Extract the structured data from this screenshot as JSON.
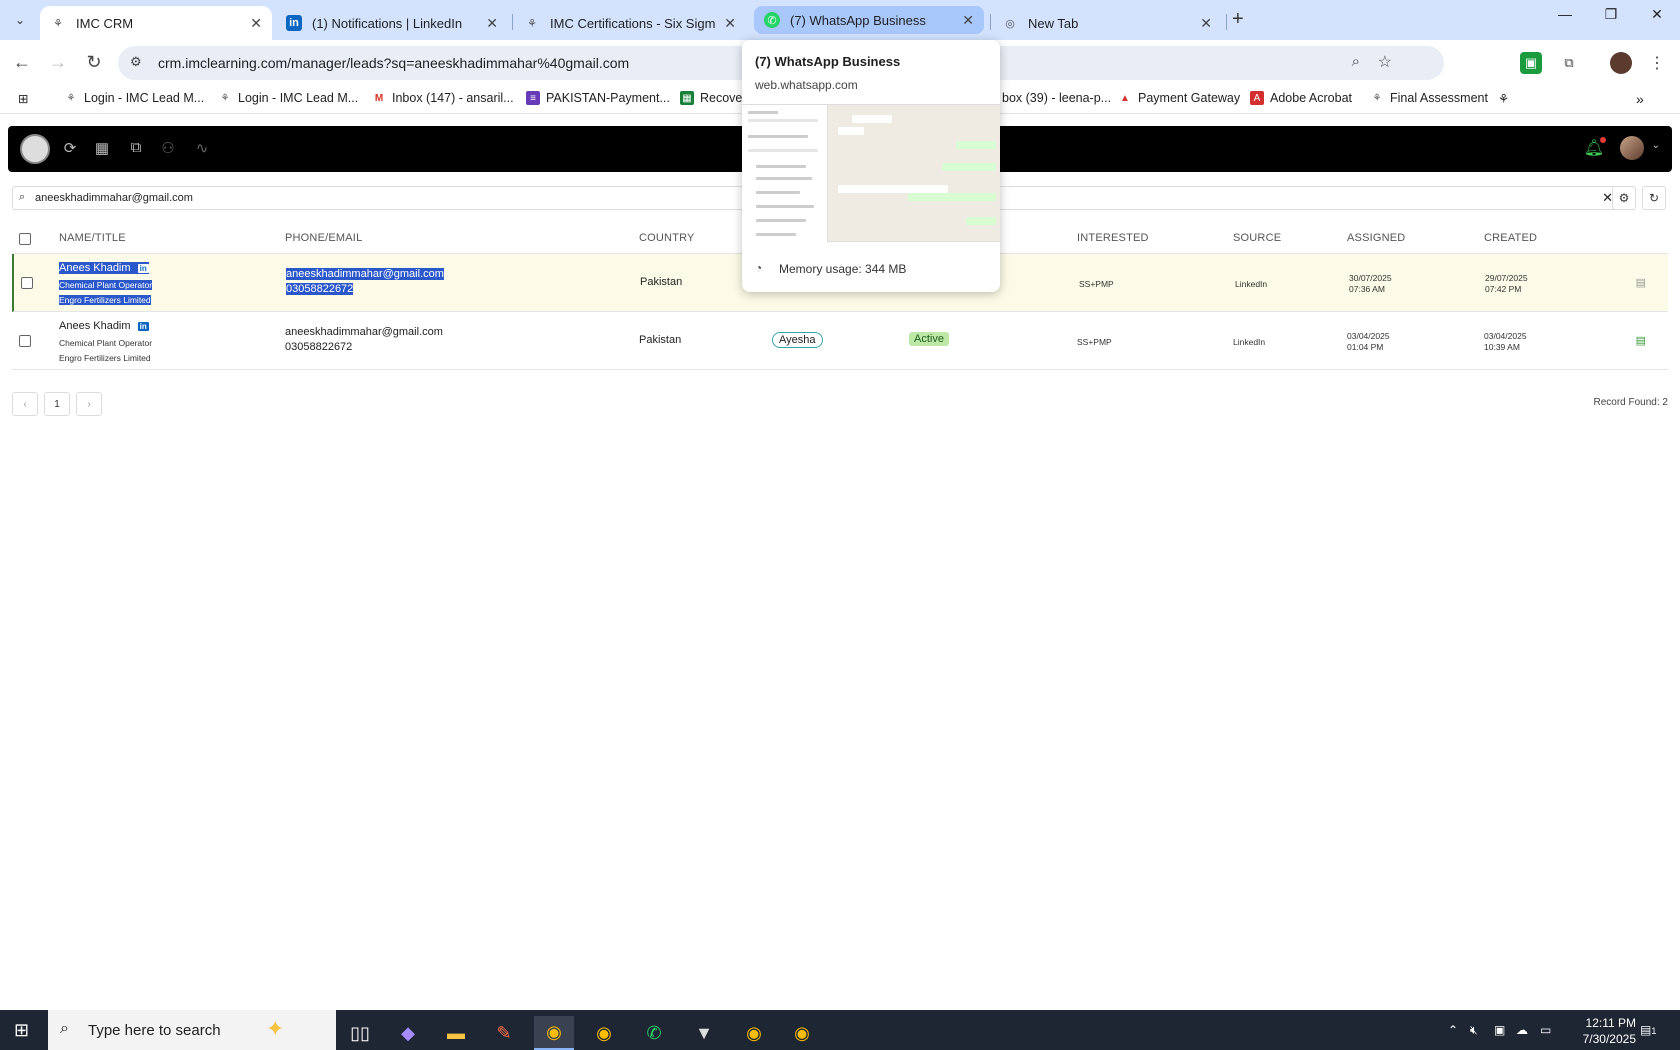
{
  "browser": {
    "tabs": [
      {
        "label": "IMC CRM",
        "icon": "imc-logo-icon"
      },
      {
        "label": "(1) Notifications | LinkedIn",
        "icon": "linkedin-icon"
      },
      {
        "label": "IMC Certifications - Six Sigma G",
        "icon": "imc-logo-icon"
      },
      {
        "label": "(7) WhatsApp Business",
        "icon": "whatsapp-icon"
      },
      {
        "label": "New Tab",
        "icon": "chrome-icon"
      }
    ],
    "url": "crm.imclearning.com/manager/leads?sq=aneeskhadimmahar%40gmail.com",
    "bookmarks": [
      "Login - IMC Lead M...",
      "Login - IMC Lead M...",
      "Inbox (147) - ansaril...",
      "PAKISTAN-Payment...",
      "Recover",
      "box (39) - leena-p...",
      "Payment Gateway",
      "Adobe Acrobat",
      "Final Assessment"
    ]
  },
  "hovercard": {
    "title": "(7) WhatsApp Business",
    "url": "web.whatsapp.com",
    "memory": "Memory usage: 344 MB"
  },
  "search": {
    "query": "aneeskhadimmahar@gmail.com"
  },
  "table": {
    "headers": [
      "NAME/TITLE",
      "PHONE/EMAIL",
      "COUNTRY",
      "INTERESTED",
      "SOURCE",
      "ASSIGNED",
      "CREATED"
    ],
    "rows": [
      {
        "name": "Anees Khadim",
        "badge": "in",
        "title": "Chemical Plant Operator",
        "company": "Engro Fertilizers Limited",
        "email": "aneeskhadimmahar@gmail.com",
        "phone": "03058822672",
        "country": "Pakistan",
        "interested": "SS+PMP",
        "source": "LinkedIn",
        "assigned_date": "30/07/2025",
        "assigned_time": "07:36 AM",
        "created_date": "29/07/2025",
        "created_time": "07:42 PM"
      },
      {
        "name": "Anees Khadim",
        "badge": "in",
        "title": "Chemical Plant Operator",
        "company": "Engro Fertilizers Limited",
        "email": "aneeskhadimmahar@gmail.com",
        "phone": "03058822672",
        "country": "Pakistan",
        "owner": "Ayesha",
        "status": "Active",
        "interested": "SS+PMP",
        "source": "LinkedIn",
        "assigned_date": "03/04/2025",
        "assigned_time": "01:04 PM",
        "created_date": "03/04/2025",
        "created_time": "10:39 AM"
      }
    ]
  },
  "pager": {
    "prev": "‹",
    "page": "1",
    "next": "›",
    "records": "Record Found: 2"
  },
  "taskbar": {
    "search_placeholder": "Type here to search",
    "time": "12:11 PM",
    "date": "7/30/2025",
    "notification_count": "1"
  },
  "colors": {
    "accent": "#2a57c9",
    "status_active": "#bde8a6",
    "linkedin": "#0a66c2"
  }
}
